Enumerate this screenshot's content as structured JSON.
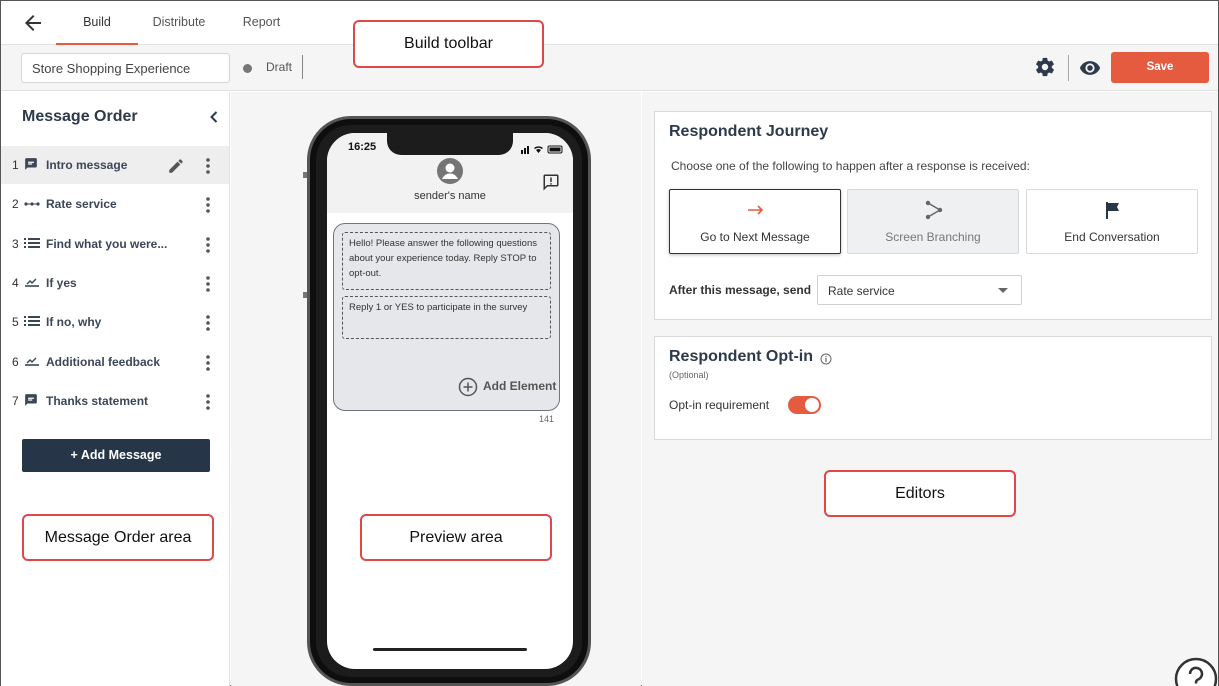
{
  "nav": {
    "tabs": [
      {
        "label": "Build",
        "active": true
      },
      {
        "label": "Distribute",
        "active": false
      },
      {
        "label": "Report",
        "active": false
      }
    ]
  },
  "toolbar": {
    "name_value": "Store Shopping Experience",
    "status": "Draft",
    "save_label": "Save"
  },
  "message_order": {
    "title": "Message Order",
    "items": [
      {
        "num": "1",
        "label": "Intro message",
        "icon": "chat-message-icon",
        "selected": true
      },
      {
        "num": "2",
        "label": "Rate service",
        "icon": "rating-dots-icon",
        "selected": false
      },
      {
        "num": "3",
        "label": "Find what you were...",
        "icon": "list-icon",
        "selected": false
      },
      {
        "num": "4",
        "label": "If yes",
        "icon": "text-entry-icon",
        "selected": false
      },
      {
        "num": "5",
        "label": "If no, why",
        "icon": "list-icon",
        "selected": false
      },
      {
        "num": "6",
        "label": "Additional feedback",
        "icon": "text-entry-icon",
        "selected": false
      },
      {
        "num": "7",
        "label": "Thanks statement",
        "icon": "chat-message-icon",
        "selected": false
      }
    ],
    "add_button": "+ Add Message"
  },
  "preview": {
    "time": "16:25",
    "sender": "sender's name",
    "segment1": "Hello! Please answer the following questions about your experience today. Reply STOP to opt-out.",
    "segment2": "Reply 1 or YES to participate in the survey",
    "add_element": "Add Element",
    "char_count": "141"
  },
  "journey": {
    "title": "Respondent Journey",
    "subtitle": "Choose one of the following to happen after a response is received:",
    "choices": [
      {
        "label": "Go to Next Message",
        "icon": "arrow-right-icon",
        "state": "active"
      },
      {
        "label": "Screen Branching",
        "icon": "branch-icon",
        "state": "disabled"
      },
      {
        "label": "End Conversation",
        "icon": "flag-icon",
        "state": "normal"
      }
    ],
    "after_label": "After this message, send",
    "after_value": "Rate service"
  },
  "optin": {
    "title": "Respondent Opt-in",
    "optional": "(Optional)",
    "requirement_label": "Opt-in requirement",
    "enabled": true
  },
  "callouts": {
    "build_toolbar": "Build toolbar",
    "message_order_area": "Message Order area",
    "preview_area": "Preview area",
    "editors": "Editors"
  },
  "colors": {
    "accent": "#e45b40",
    "dark_button": "#273548",
    "callout_border": "#e04848"
  }
}
